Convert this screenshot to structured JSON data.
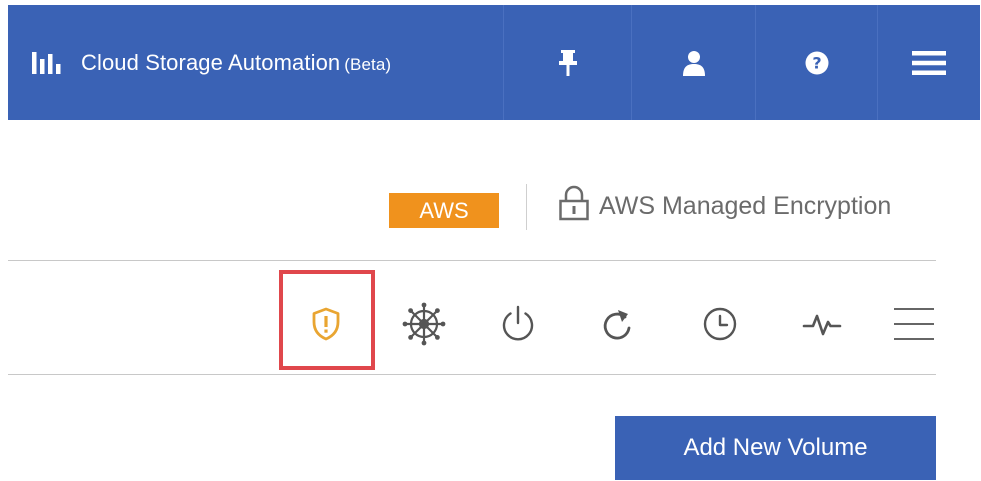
{
  "topbar": {
    "title": "Cloud Storage Automation",
    "title_suffix": "(Beta)",
    "brand_icon": "bar-chart-icon",
    "buttons": [
      {
        "icon": "pin-icon"
      },
      {
        "icon": "user-icon"
      },
      {
        "icon": "help-icon"
      },
      {
        "icon": "hamburger-menu-icon"
      }
    ],
    "colors": {
      "background": "#3a62b5",
      "text": "#ffffff"
    }
  },
  "provider": {
    "badge": "AWS",
    "badge_color": "#f0921d",
    "encryption_label": "AWS Managed Encryption",
    "encryption_icon": "lock-icon"
  },
  "toolbar": {
    "icons": [
      {
        "name": "shield-alert-icon",
        "color": "#e9a531",
        "highlighted": true
      },
      {
        "name": "kubernetes-icon"
      },
      {
        "name": "power-icon"
      },
      {
        "name": "refresh-icon"
      },
      {
        "name": "clock-icon"
      },
      {
        "name": "pulse-icon"
      },
      {
        "name": "menu-icon"
      }
    ],
    "highlight_color": "#e0474c"
  },
  "actions": {
    "add_volume_label": "Add New Volume"
  }
}
